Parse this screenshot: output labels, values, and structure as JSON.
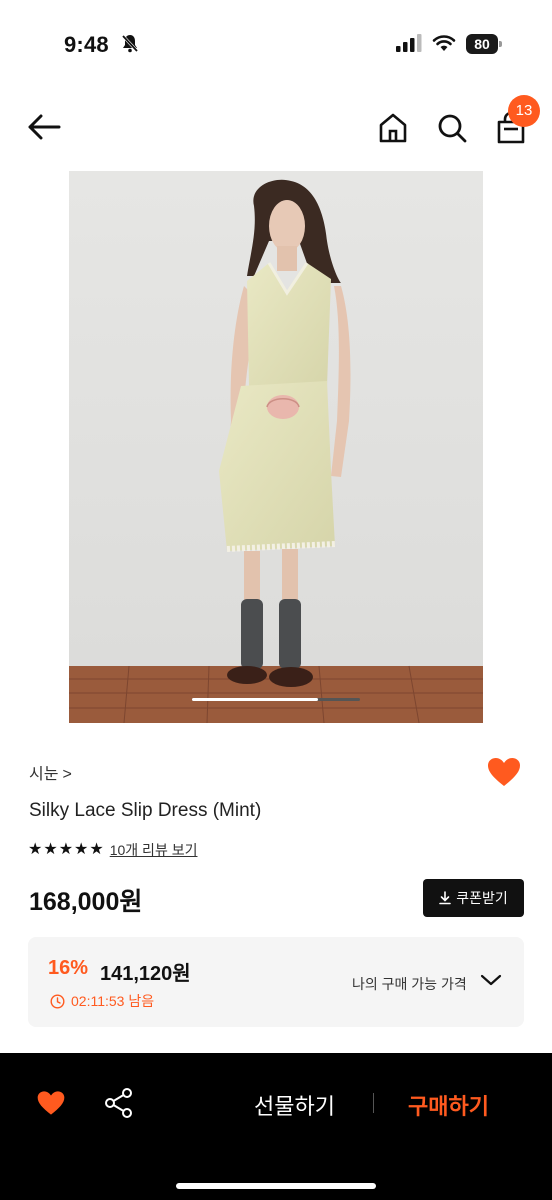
{
  "status_bar": {
    "time": "9:48",
    "battery": "80",
    "icons": [
      "bell-slash-icon",
      "signal-icon",
      "wifi-icon",
      "battery-icon"
    ]
  },
  "header": {
    "icons": [
      "back-arrow-icon",
      "home-icon",
      "search-icon",
      "shopping-bag-icon"
    ],
    "cart_count": "13"
  },
  "product_image": {
    "carousel_progress": 0.75
  },
  "product": {
    "brand": "시눈",
    "brand_chevron": ">",
    "name": "Silky Lace Slip Dress (Mint)",
    "rating_stars": 5,
    "stars": [
      "★",
      "★",
      "★",
      "★",
      "★"
    ],
    "review_link": "10개 리뷰 보기",
    "price": "168,000원",
    "coupon_button": "쿠폰받기",
    "liked": true
  },
  "my_price": {
    "discount": "16%",
    "price": "141,120원",
    "timer": "02:11:53 남음",
    "label": "나의 구매 가능 가격"
  },
  "bottom_bar": {
    "gift": "선물하기",
    "buy": "구매하기"
  },
  "colors": {
    "accent": "#ff5a1f",
    "black": "#000000",
    "box_bg": "#f5f5f5"
  }
}
